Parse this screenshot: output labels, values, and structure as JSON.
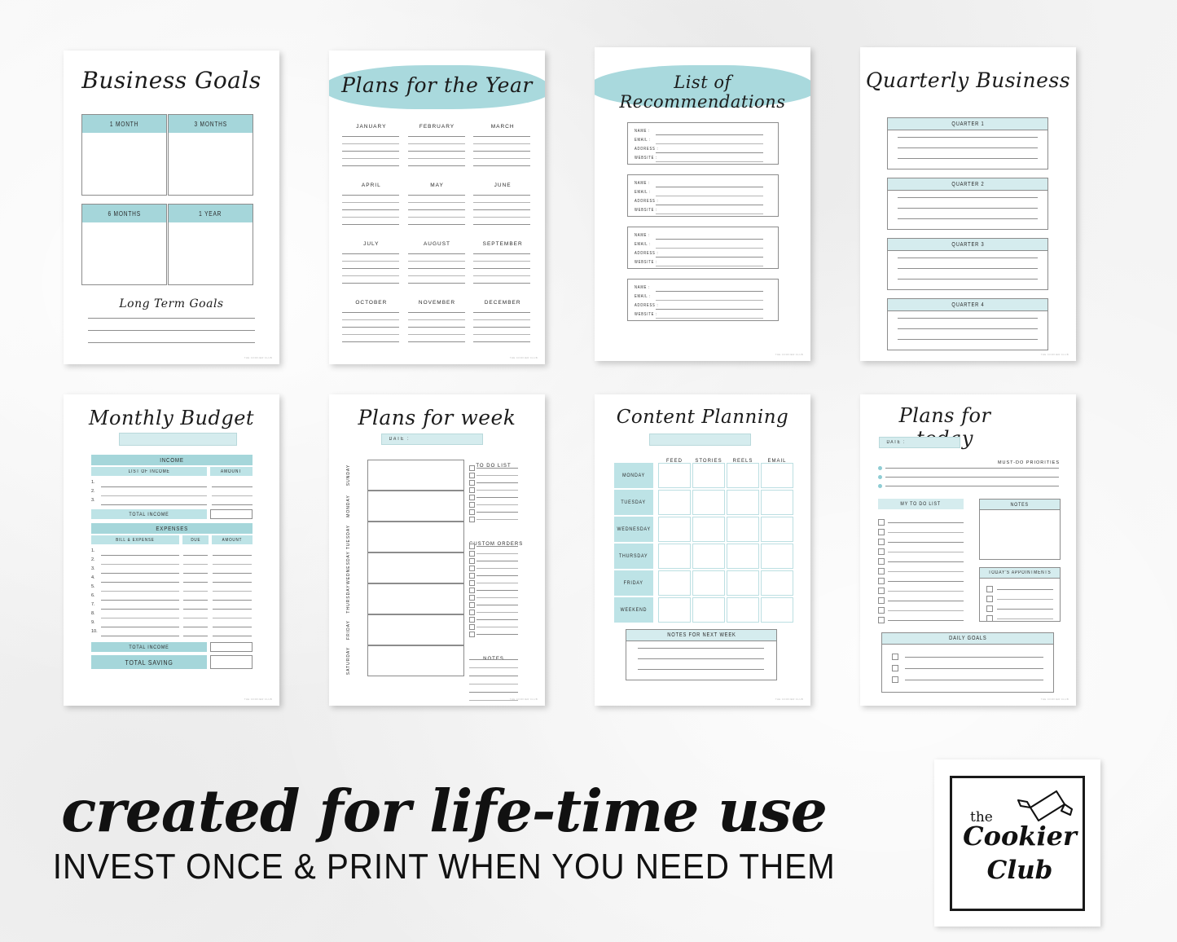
{
  "background_color": "#f5f5f5",
  "accent_colors": {
    "teal_dark": "#a5d6da",
    "teal_mid": "#bde3e6",
    "teal_light": "#d5ecee",
    "line": "#8e8e8e",
    "ink": "#1b1b1b"
  },
  "watermark": "THE COOKIER CLUB",
  "pages": {
    "business_goals": {
      "title": "Business Goals",
      "boxes": [
        "1 MONTH",
        "3 MONTHS",
        "6 MONTHS",
        "1 YEAR"
      ],
      "subtitle": "Long Term Goals",
      "long_term_lines": 3
    },
    "plans_for_the_year": {
      "title": "Plans for the Year",
      "months": [
        "JANUARY",
        "FEBRUARY",
        "MARCH",
        "APRIL",
        "MAY",
        "JUNE",
        "JULY",
        "AUGUST",
        "SEPTEMBER",
        "OCTOBER",
        "NOVEMBER",
        "DECEMBER"
      ],
      "lines_per_month": 5
    },
    "list_of_recommendations": {
      "title": "List of Recommendations",
      "fields": [
        "NAME :",
        "EMAIL :",
        "ADDRESS :",
        "WEBSITE :"
      ],
      "entry_count": 4
    },
    "quarterly_business": {
      "title": "Quarterly Business",
      "quarters": [
        "QUARTER 1",
        "QUARTER 2",
        "QUARTER 3",
        "QUARTER 4"
      ],
      "lines_per_quarter": 3
    },
    "monthly_budget": {
      "title": "Monthly Budget",
      "month_field_value": "",
      "income_header": "INCOME",
      "income_columns": [
        "LIST OF INCOME",
        "AMOUNT"
      ],
      "income_rows": [
        "1.",
        "2.",
        "3."
      ],
      "total_income_label": "TOTAL INCOME",
      "expenses_header": "EXPENSES",
      "expenses_columns": [
        "BILL & EXPENSE",
        "DUE",
        "AMOUNT"
      ],
      "expense_rows": [
        "1.",
        "2.",
        "3.",
        "4.",
        "5.",
        "6.",
        "7.",
        "8.",
        "9.",
        "10."
      ],
      "total_income_label_2": "TOTAL INCOME",
      "total_saving_label": "TOTAL SAVING"
    },
    "plans_for_week": {
      "title": "Plans for week",
      "date_label": "DATE :",
      "days": [
        "SUNDAY",
        "MONDAY",
        "TUESDAY",
        "WEDNESDAY",
        "THURSDAY",
        "FRIDAY",
        "SATURDAY"
      ],
      "todo_header": "TO DO LIST",
      "todo_count": 8,
      "custom_orders_header": "CUSTOM ORDERS",
      "custom_orders_count": 13,
      "notes_header": "NOTES",
      "notes_lines": 6
    },
    "content_planning": {
      "title": "Content Planning",
      "week_field_value": "",
      "columns": [
        "FEED",
        "STORIES",
        "REELS",
        "EMAIL"
      ],
      "rows": [
        "MONDAY",
        "TUESDAY",
        "WEDNESDAY",
        "THURSDAY",
        "FRIDAY",
        "WEEKEND"
      ],
      "notes_header": "NOTES FOR NEXT WEEK",
      "notes_lines": 3
    },
    "plans_for_today": {
      "title": "Plans for today",
      "date_label": "DATE :",
      "priorities_header": "MUST-DO PRIORITIES",
      "priorities_count": 3,
      "todo_header": "MY TO DO LIST",
      "todo_count": 11,
      "notes_header": "NOTES",
      "appointments_header": "TODAY'S APPOINTMENTS",
      "appointments_count": 4,
      "daily_goals_header": "DAILY GOALS",
      "daily_goals_count": 3
    }
  },
  "banner": {
    "line1": "created for life-time use",
    "line2": "INVEST ONCE & PRINT WHEN YOU NEED THEM"
  },
  "logo": {
    "the": "the",
    "cookier": "Cookier",
    "club": "Club",
    "icon": "rolling-pin-icon"
  }
}
